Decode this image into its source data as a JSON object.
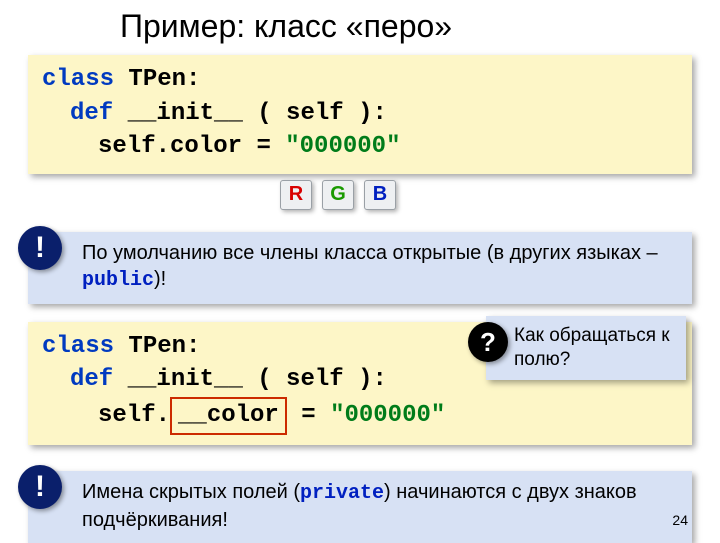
{
  "title": "Пример: класс «перо»",
  "code1": {
    "l1a": "class",
    "l1b": "TPen:",
    "l2a": "def",
    "l2b": "__init__",
    "l2c": "( self ):",
    "l3a": "self.",
    "l3b": "color",
    "l3c": "=",
    "l3d": "\"000000\""
  },
  "rgb": {
    "r": "R",
    "g": "G",
    "b": "B"
  },
  "note1": {
    "badge": "!",
    "pre": "По умолчанию все члены класса открытые (в других языках – ",
    "kw": "public",
    "post": ")!"
  },
  "code2": {
    "l1a": "class",
    "l1b": "TPen:",
    "l2a": "def",
    "l2b": "__init__",
    "l2c": "( self ):",
    "l3a": "self.",
    "l3b": "__color",
    "l3c": "=",
    "l3d": "\"000000\""
  },
  "sidenote": {
    "badge": "?",
    "text": "Как обращаться к полю?"
  },
  "note2": {
    "badge": "!",
    "pre": "Имена скрытых полей (",
    "kw": "private",
    "post": ") начинаются с двух знаков подчёркивания!"
  },
  "page": "24"
}
